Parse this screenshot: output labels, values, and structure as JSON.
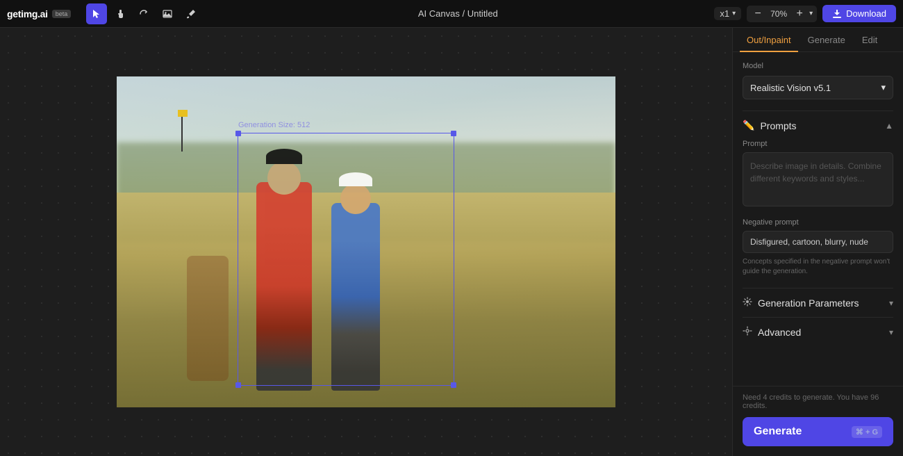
{
  "app": {
    "logo": "getimg.ai",
    "beta": "beta",
    "title": "AI Canvas / Untitled",
    "zoom": "70%",
    "x1": "x1",
    "download_label": "Download"
  },
  "tools": [
    {
      "id": "select",
      "icon": "▶",
      "active": true
    },
    {
      "id": "hand",
      "icon": "✋",
      "active": false
    },
    {
      "id": "rotate",
      "icon": "↺",
      "active": false
    },
    {
      "id": "image",
      "icon": "🖼",
      "active": false
    },
    {
      "id": "brush",
      "icon": "◈",
      "active": false
    }
  ],
  "canvas": {
    "generation_label": "Generation Size: 512"
  },
  "panel": {
    "tabs": [
      {
        "id": "out-inpaint",
        "label": "Out/Inpaint",
        "active": true
      },
      {
        "id": "generate",
        "label": "Generate",
        "active": false
      },
      {
        "id": "edit",
        "label": "Edit",
        "active": false
      }
    ],
    "model_label": "Model",
    "model_value": "Realistic Vision v5.1",
    "sections": {
      "prompts": {
        "title": "Prompts",
        "icon": "✏",
        "expanded": true,
        "prompt_label": "Prompt",
        "prompt_placeholder": "Describe image in details. Combine different keywords and styles...",
        "negative_prompt_label": "Negative prompt",
        "negative_prompt_value": "Disfigured, cartoon, blurry, nude",
        "hint": "Concepts specified in the negative prompt won't guide the generation."
      },
      "generation_parameters": {
        "title": "Generation Parameters",
        "icon": "⚙",
        "expanded": false
      },
      "advanced": {
        "title": "Advanced",
        "icon": "⚙",
        "expanded": false
      }
    },
    "credits_text": "Need 4 credits to generate. You have 96 credits.",
    "generate_label": "Generate",
    "generate_shortcut": "⌘ + G"
  }
}
